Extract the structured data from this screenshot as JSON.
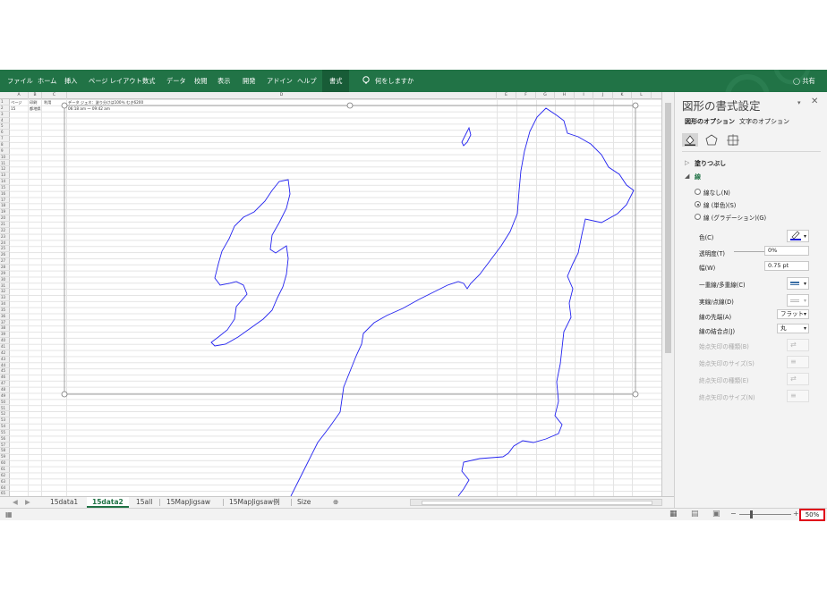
{
  "ribbon": {
    "tabs": [
      "ファイル",
      "ホーム",
      "挿入",
      "ページ レイアウト",
      "数式",
      "データ",
      "校閲",
      "表示",
      "開発",
      "アドイン",
      "ヘルプ",
      "書式"
    ],
    "tell_me": "何をしますか",
    "share": "共有",
    "colors": {
      "ribbon_bg": "#217346",
      "active_tab_bg": "#185c37"
    }
  },
  "sheet": {
    "columns": [
      "A",
      "B",
      "C",
      "D",
      "E",
      "F",
      "G",
      "H",
      "I",
      "J",
      "K",
      "L"
    ],
    "rows": [
      "1",
      "2",
      "3",
      "4",
      "5",
      "6",
      "7",
      "8",
      "9",
      "10",
      "11",
      "12",
      "13",
      "14",
      "15",
      "16",
      "17",
      "18",
      "19",
      "20",
      "21",
      "22",
      "23",
      "24",
      "25",
      "26",
      "27",
      "28",
      "29",
      "30",
      "31",
      "32",
      "33",
      "34",
      "35",
      "36",
      "37",
      "38",
      "39",
      "40",
      "41",
      "42",
      "43",
      "44",
      "45",
      "46",
      "47",
      "48",
      "49",
      "50",
      "51",
      "52",
      "53",
      "54",
      "55",
      "56",
      "57",
      "58",
      "59",
      "60",
      "61",
      "62",
      "63",
      "64",
      "65"
    ],
    "cells": {
      "a1": "ページ",
      "b1": "印刷",
      "c1": "利用",
      "d1": "データ ジェネ：塗り分けは100％ むき6200",
      "a2": "15",
      "b2": "都地県",
      "d2": "06:18 am ～ 09:42 am"
    },
    "shape_color": "#2323f0"
  },
  "sheet_tabs": {
    "tabs": [
      "15data1",
      "15data2",
      "15all",
      "15MapJigsaw",
      "15MapJigsaw例",
      "Size"
    ],
    "active": "15data2"
  },
  "status_bar": {
    "zoom": "50%"
  },
  "format_pane": {
    "title": "図形の書式設定",
    "tab_shape": "図形のオプション",
    "tab_text": "文字のオプション",
    "section_fill": "塗りつぶし",
    "section_line": "線",
    "radio_none": "線なし(N)",
    "radio_solid": "線 (単色)(S)",
    "radio_gradient": "線 (グラデーション)(G)",
    "color_label": "色(C)",
    "transparency_label": "透明度(T)",
    "transparency_value": "0%",
    "width_label": "幅(W)",
    "width_value": "0.75 pt",
    "compound_label": "一重線/多重線(C)",
    "dash_label": "実線/点線(D)",
    "cap_label": "線の先端(A)",
    "cap_value": "フラット",
    "join_label": "線の結合点(J)",
    "join_value": "丸",
    "begin_arrow_type": "始点矢印の種類(B)",
    "begin_arrow_size": "始点矢印のサイズ(S)",
    "end_arrow_type": "終点矢印の種類(E)",
    "end_arrow_size": "終点矢印のサイズ(N)",
    "line_color": "#1f1fd6"
  }
}
